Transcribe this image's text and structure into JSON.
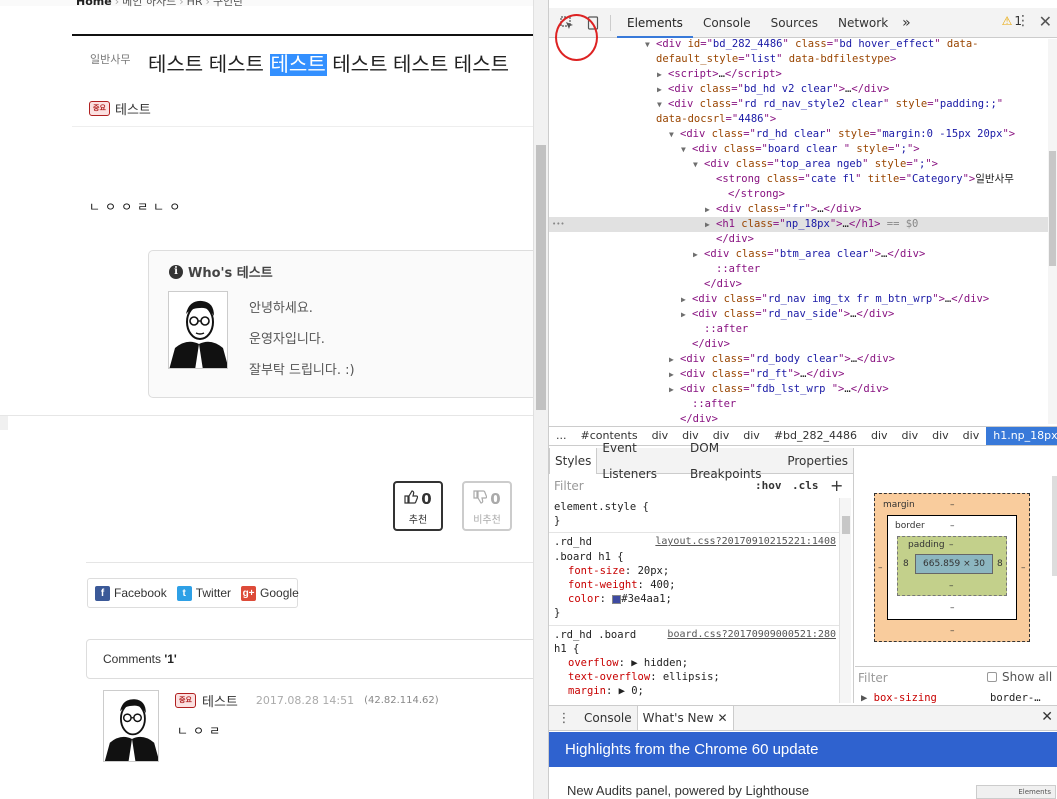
{
  "left": {
    "breadcrumb": [
      "Home",
      "메인 하사드",
      "HR",
      "구인란"
    ],
    "category": "일반사무",
    "title_before": "테스트 테스트 ",
    "title_highlight": "테스트",
    "title_after": " 테스트 테스트 테스트",
    "author": "테스트",
    "author_badge": "중요",
    "content_text": "ㄴㅇㅇㄹㄴㅇ",
    "whos": {
      "title": "Who's 테스트",
      "info_glyph": "i",
      "lines": [
        "안녕하세요.",
        "운영자입니다.",
        "잘부탁 드립니다. :)"
      ]
    },
    "vote_up": {
      "count": "0",
      "label": "추천"
    },
    "vote_down": {
      "count": "0",
      "label": "비추천"
    },
    "share": [
      {
        "label": "Facebook",
        "glyph": "f",
        "color": "#3b5998"
      },
      {
        "label": "Twitter",
        "glyph": "t",
        "color": "#2ea0e6"
      },
      {
        "label": "Google",
        "glyph": "g+",
        "color": "#dd4b39"
      }
    ],
    "comments_label": "Comments ",
    "comments_count": "'1'",
    "comment": {
      "nick": "테스트",
      "date": "2017.08.28 14:51",
      "ip": "(42.82.114.62)",
      "text": "ㄴㅇㄹ"
    }
  },
  "devtools": {
    "tabs": [
      "Elements",
      "Console",
      "Sources",
      "Network"
    ],
    "more": "»",
    "warn_count": "1",
    "colors": {
      "accent": "#3879d9",
      "banner": "#2f62cf",
      "tag": "#881280",
      "attr_name": "#994500",
      "attr_value": "#1a1aa6"
    },
    "dom_lines": [
      {
        "indent": 96,
        "arrow": "▼",
        "html": "<span class='t'>&lt;div </span><span class='an'>id</span><span class='t'>=\"</span><span class='av'>bd_282_4486</span><span class='t'>\" </span><span class='an'>class</span><span class='t'>=\"</span><span class='av'>bd   hover_effect</span><span class='t'>\" </span><span class='an'>data-</span>"
      },
      {
        "indent": 96,
        "arrow": "",
        "html": "<span class='an'>default_style</span><span class='t'>=\"</span><span class='av'>list</span><span class='t'>\" </span><span class='an'>data-bdfilestype</span><span class='t'>&gt;</span>"
      },
      {
        "indent": 108,
        "arrow": "▶",
        "html": "<span class='t'>&lt;script&gt;</span><span class='tx'>…</span><span class='t'>&lt;/script&gt;</span>"
      },
      {
        "indent": 108,
        "arrow": "▶",
        "html": "<span class='t'>&lt;div </span><span class='an'>class</span><span class='t'>=\"</span><span class='av'>bd_hd v2 clear</span><span class='t'>\"&gt;</span><span class='tx'>…</span><span class='t'>&lt;/div&gt;</span>"
      },
      {
        "indent": 108,
        "arrow": "▼",
        "html": "<span class='t'>&lt;div </span><span class='an'>class</span><span class='t'>=\"</span><span class='av'>rd rd_nav_style2 clear</span><span class='t'>\" </span><span class='an'>style</span><span class='t'>=\"</span><span class='av'>padding:;</span><span class='t'>\"</span>"
      },
      {
        "indent": 96,
        "arrow": "",
        "html": "<span class='an'>data-docsrl</span><span class='t'>=\"</span><span class='av'>4486</span><span class='t'>\"&gt;</span>"
      },
      {
        "indent": 120,
        "arrow": "▼",
        "html": "<span class='t'>&lt;div </span><span class='an'>class</span><span class='t'>=\"</span><span class='av'>rd_hd clear</span><span class='t'>\" </span><span class='an'>style</span><span class='t'>=\"</span><span class='av'>margin:0 -15px 20px</span><span class='t'>\"&gt;</span>"
      },
      {
        "indent": 132,
        "arrow": "▼",
        "html": "<span class='t'>&lt;div </span><span class='an'>class</span><span class='t'>=\"</span><span class='av'>board clear </span><span class='t'>\" </span><span class='an'>style</span><span class='t'>=\"</span><span class='av'>;</span><span class='t'>\"&gt;</span>"
      },
      {
        "indent": 144,
        "arrow": "▼",
        "html": "<span class='t'>&lt;div </span><span class='an'>class</span><span class='t'>=\"</span><span class='av'>top_area ngeb</span><span class='t'>\" </span><span class='an'>style</span><span class='t'>=\"</span><span class='av'>;</span><span class='t'>\"&gt;</span>"
      },
      {
        "indent": 156,
        "arrow": "",
        "html": "<span class='t'>&lt;strong </span><span class='an'>class</span><span class='t'>=\"</span><span class='av'>cate fl</span><span class='t'>\" </span><span class='an'>title</span><span class='t'>=\"</span><span class='av'>Category</span><span class='t'>\"&gt;</span><span class='tx'>일반사무</span>"
      },
      {
        "indent": 168,
        "arrow": "",
        "html": "<span class='t'>&lt;/strong&gt;</span>"
      },
      {
        "indent": 156,
        "arrow": "▶",
        "html": "<span class='t'>&lt;div </span><span class='an'>class</span><span class='t'>=\"</span><span class='av'>fr</span><span class='t'>\"&gt;</span><span class='tx'>…</span><span class='t'>&lt;/div&gt;</span>"
      },
      {
        "indent": 156,
        "arrow": "▶",
        "sel": true,
        "html": "<span class='t'>&lt;h1 </span><span class='an'>class</span><span class='t'>=\"</span><span class='av'>np_18px</span><span class='t'>\"&gt;</span><span class='tx'>…</span><span class='t'>&lt;/h1&gt;</span><span class='eq'> == $0</span>"
      },
      {
        "indent": 156,
        "arrow": "",
        "html": "<span class='t'>&lt;/div&gt;</span>"
      },
      {
        "indent": 144,
        "arrow": "▶",
        "html": "<span class='t'>&lt;div </span><span class='an'>class</span><span class='t'>=\"</span><span class='av'>btm_area clear</span><span class='t'>\"&gt;</span><span class='tx'>…</span><span class='t'>&lt;/div&gt;</span>"
      },
      {
        "indent": 156,
        "arrow": "",
        "html": "<span class='ps'>::after</span>"
      },
      {
        "indent": 144,
        "arrow": "",
        "html": "<span class='t'>&lt;/div&gt;</span>"
      },
      {
        "indent": 132,
        "arrow": "▶",
        "html": "<span class='t'>&lt;div </span><span class='an'>class</span><span class='t'>=\"</span><span class='av'>rd_nav img_tx fr m_btn_wrp</span><span class='t'>\"&gt;</span><span class='tx'>…</span><span class='t'>&lt;/div&gt;</span>"
      },
      {
        "indent": 132,
        "arrow": "▶",
        "html": "<span class='t'>&lt;div </span><span class='an'>class</span><span class='t'>=\"</span><span class='av'>rd_nav_side</span><span class='t'>\"&gt;</span><span class='tx'>…</span><span class='t'>&lt;/div&gt;</span>"
      },
      {
        "indent": 144,
        "arrow": "",
        "html": "<span class='ps'>::after</span>"
      },
      {
        "indent": 132,
        "arrow": "",
        "html": "<span class='t'>&lt;/div&gt;</span>"
      },
      {
        "indent": 120,
        "arrow": "▶",
        "html": "<span class='t'>&lt;div </span><span class='an'>class</span><span class='t'>=\"</span><span class='av'>rd_body clear</span><span class='t'>\"&gt;</span><span class='tx'>…</span><span class='t'>&lt;/div&gt;</span>"
      },
      {
        "indent": 120,
        "arrow": "▶",
        "html": "<span class='t'>&lt;div </span><span class='an'>class</span><span class='t'>=\"</span><span class='av'>rd_ft</span><span class='t'>\"&gt;</span><span class='tx'>…</span><span class='t'>&lt;/div&gt;</span>"
      },
      {
        "indent": 120,
        "arrow": "▶",
        "html": "<span class='t'>&lt;div </span><span class='an'>class</span><span class='t'>=\"</span><span class='av'>fdb_lst_wrp  </span><span class='t'>\"&gt;</span><span class='tx'>…</span><span class='t'>&lt;/div&gt;</span>"
      },
      {
        "indent": 132,
        "arrow": "",
        "html": "<span class='ps'>::after</span>"
      },
      {
        "indent": 120,
        "arrow": "",
        "html": "<span class='t'>&lt;/div&gt;</span>"
      }
    ],
    "crumbs": [
      "...",
      "#contents",
      "div",
      "div",
      "div",
      "div",
      "#bd_282_4486",
      "div",
      "div",
      "div",
      "div",
      "h1.np_18px"
    ],
    "style_tabs": [
      "Styles",
      "Event Listeners",
      "DOM Breakpoints",
      "Properties"
    ],
    "filter_placeholder": "Filter",
    "hov": ":hov",
    "cls": ".cls",
    "plus": "+",
    "element_style": "element.style {",
    "rule1": {
      "selector_line1": ".rd_hd",
      "selector_line2": ".board h1 {",
      "source": "layout.css?20170910215221:1408",
      "props": [
        {
          "name": "font-size",
          "value": "20px;"
        },
        {
          "name": "font-weight",
          "value": "400;"
        },
        {
          "name": "color",
          "value": "#3e4aa1;"
        }
      ]
    },
    "rule2": {
      "selector_line1": ".rd_hd .board",
      "selector_line2": "h1 {",
      "source": "board.css?20170909000521:280",
      "props": [
        {
          "name": "overflow",
          "value": "▶ hidden;"
        },
        {
          "name": "text-overflow",
          "value": "ellipsis;"
        },
        {
          "name": "margin",
          "value": "▶ 0;"
        }
      ]
    },
    "boxmodel": {
      "margin_label": "margin",
      "border_label": "border",
      "padding_label": "padding",
      "dash": "–",
      "content": "665.859 × 30",
      "pad_left": "8",
      "pad_right": "8"
    },
    "computed_filter": "Filter",
    "show_all": "Show all",
    "computed_prop": "box-sizing",
    "computed_val": "border-…",
    "drawer_tabs": [
      "Console",
      "What's New"
    ],
    "banner": "Highlights from the Chrome 60 update",
    "whatsnew_item": "New Audits panel, powered by Lighthouse",
    "mini_label": "Elements"
  }
}
